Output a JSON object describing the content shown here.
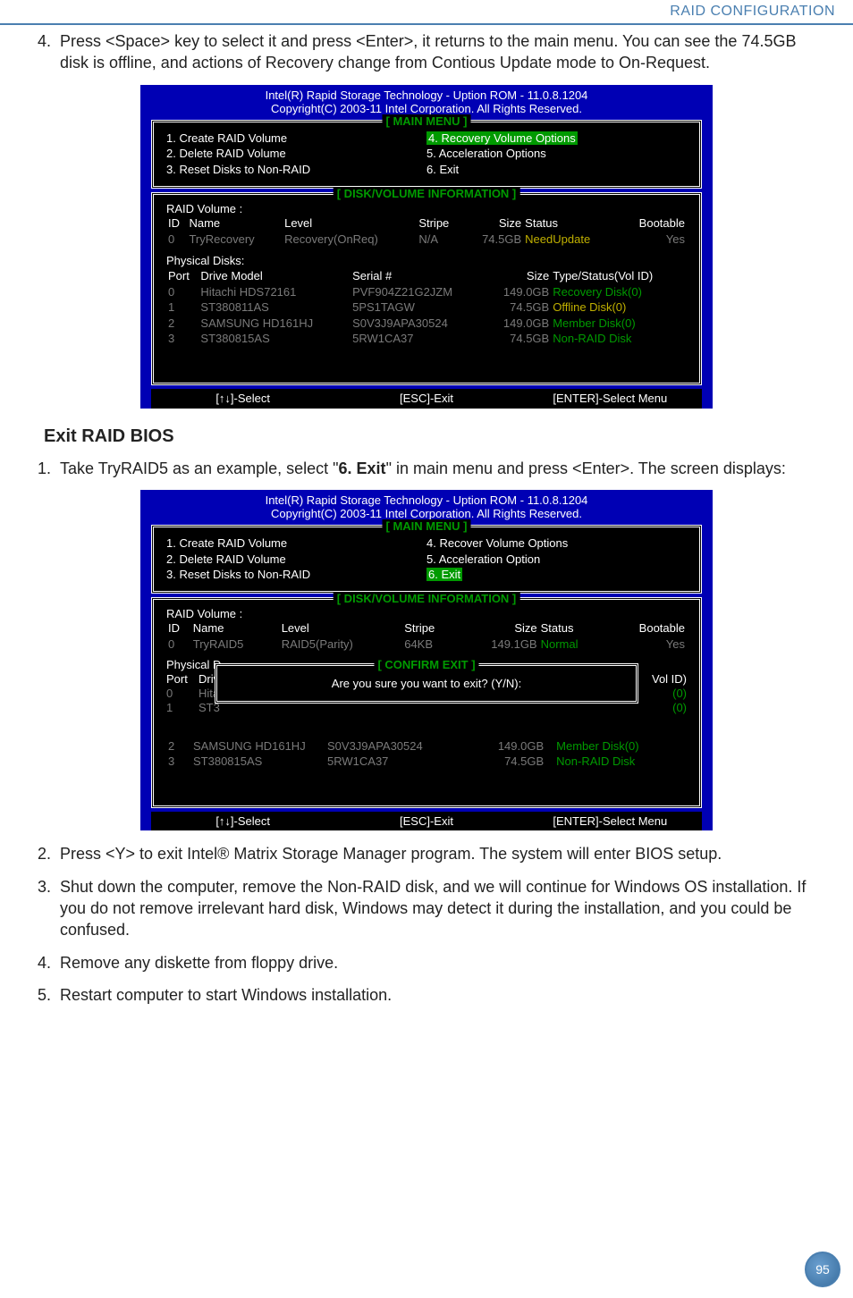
{
  "header": {
    "title": "RAID CONFIGURATION"
  },
  "step4": {
    "num": "4.",
    "text": "Press <Space> key to select it and press <Enter>, it returns to the main menu. You can see the 74.5GB disk is offline, and actions of Recovery change from Contious Update mode to On-Request."
  },
  "bios1": {
    "title1": "Intel(R) Rapid Storage Technology  -  Uption ROM - 11.0.8.1204",
    "title2": "Copyright(C) 2003-11 Intel Corporation.  All Rights Reserved.",
    "menuTitle": "[ MAIN MENU ]",
    "menuLeft": [
      "1. Create RAID Volume",
      "2. Delete RAID Volume",
      "3. Reset Disks to Non-RAID"
    ],
    "menuRight": [
      "4. Recovery Volume Options",
      "5. Acceleration Options",
      "6. Exit"
    ],
    "diskTitle": "[ DISK/VOLUME INFORMATION ]",
    "raidVolLabel": "RAID Volume :",
    "volHdr": {
      "id": "ID",
      "name": "Name",
      "level": "Level",
      "stripe": "Stripe",
      "size": "Size",
      "status": "Status",
      "bootable": "Bootable"
    },
    "volRow": {
      "id": "0",
      "name": "TryRecovery",
      "level": "Recovery(OnReq)",
      "stripe": "N/A",
      "size": "74.5GB",
      "status": "NeedUpdate",
      "bootable": "Yes"
    },
    "physLabel": "Physical Disks:",
    "physHdr": {
      "port": "Port",
      "model": "Drive Model",
      "serial": "Serial #",
      "size": "Size",
      "type": "Type/Status(Vol ID)"
    },
    "physRows": [
      {
        "port": "0",
        "model": "Hitachi HDS72161",
        "serial": "PVF904Z21G2JZM",
        "size": "149.0GB",
        "type": "Recovery Disk(0)"
      },
      {
        "port": "1",
        "model": "ST380811AS",
        "serial": "5PS1TAGW",
        "size": "74.5GB",
        "type": "Offline Disk(0)"
      },
      {
        "port": "2",
        "model": "SAMSUNG HD161HJ",
        "serial": "S0V3J9APA30524",
        "size": "149.0GB",
        "type": "Member Disk(0)"
      },
      {
        "port": "3",
        "model": "ST380815AS",
        "serial": "5RW1CA37",
        "size": "74.5GB",
        "type": "Non-RAID Disk"
      }
    ],
    "footer": {
      "select": "[↑↓]-Select",
      "esc": "[ESC]-Exit",
      "enter": "[ENTER]-Select Menu"
    }
  },
  "exitTitle": "Exit RAID BIOS",
  "exitStep1": {
    "num": "1.",
    "pre": "Take TryRAID5 as an example, select \"",
    "bold": "6. Exit",
    "post": "\" in main menu and press <Enter>. The screen displays:"
  },
  "bios2": {
    "title1": "Intel(R) Rapid Storage Technology  -  Uption ROM - 11.0.8.1204",
    "title2": "Copyright(C) 2003-11 Intel Corporation.  All Rights Reserved.",
    "menuTitle": "[ MAIN MENU ]",
    "menuLeft": [
      "1. Create RAID Volume",
      "2. Delete RAID Volume",
      "3. Reset Disks to Non-RAID"
    ],
    "menuRight": [
      "4. Recover Volume Options",
      "5. Acceleration Option",
      "6. Exit"
    ],
    "diskTitle": "[ DISK/VOLUME INFORMATION ]",
    "raidVolLabel": "RAID Volume :",
    "volHdr": {
      "id": "ID",
      "name": "Name",
      "level": "Level",
      "stripe": "Stripe",
      "size": "Size",
      "status": "Status",
      "bootable": "Bootable"
    },
    "volRow": {
      "id": "0",
      "name": "TryRAID5",
      "level": "RAID5(Parity)",
      "stripe": "64KB",
      "size": "149.1GB",
      "status": "Normal",
      "bootable": "Yes"
    },
    "confirmTitle": "[ CONFIRM EXIT ]",
    "confirmText": "Are you sure you want to exit? (Y/N):",
    "physLabel": "Physical D",
    "physHdrPort": "Port",
    "physHdrModel": "Driv",
    "fragVol": "Vol ID)",
    "frag0a": "(0)",
    "frag0b": "(0)",
    "rows": [
      {
        "port": "0",
        "model": "Hita"
      },
      {
        "port": "1",
        "model": "ST3"
      }
    ],
    "visRows": [
      {
        "port": "2",
        "model": "SAMSUNG HD161HJ",
        "serial": "S0V3J9APA30524",
        "size": "149.0GB",
        "type": "Member Disk(0)"
      },
      {
        "port": "3",
        "model": "ST380815AS",
        "serial": "5RW1CA37",
        "size": "74.5GB",
        "type": "Non-RAID Disk"
      }
    ],
    "footer": {
      "select": "[↑↓]-Select",
      "esc": "[ESC]-Exit",
      "enter": "[ENTER]-Select Menu"
    }
  },
  "steps": [
    {
      "num": "2.",
      "text": "Press <Y> to exit Intel® Matrix Storage Manager program. The system will enter BIOS setup."
    },
    {
      "num": "3.",
      "text": "Shut down the computer, remove the Non-RAID disk, and we will continue for Windows OS installation. If you do not remove irrelevant hard disk, Windows may detect it during the installation, and you could be confused."
    },
    {
      "num": "4.",
      "text": "Remove any diskette from floppy drive."
    },
    {
      "num": "5.",
      "text": "Restart computer to start Windows installation."
    }
  ],
  "pageNum": "95"
}
